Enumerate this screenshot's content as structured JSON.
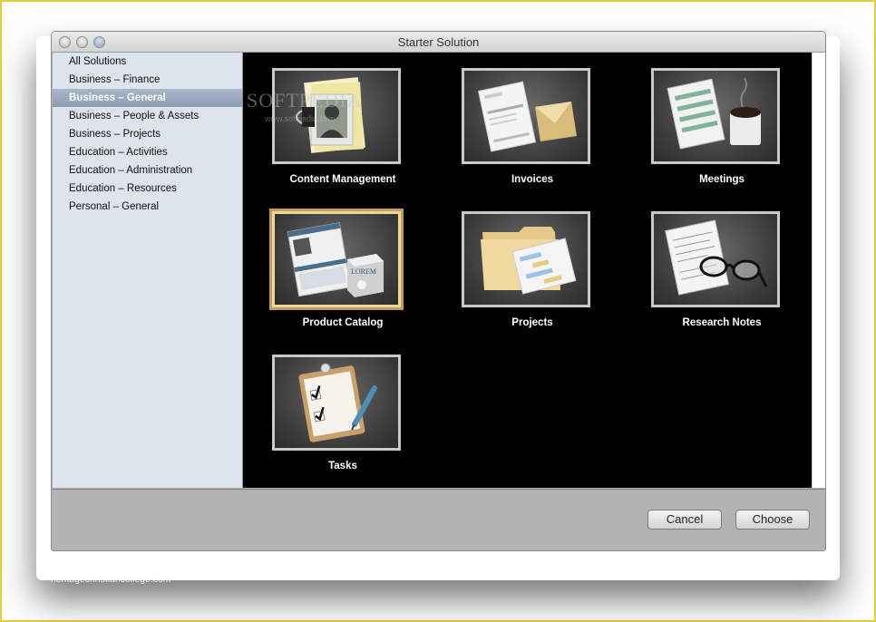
{
  "window": {
    "title": "Starter Solution"
  },
  "sidebar": {
    "items": [
      {
        "label": "All Solutions",
        "selected": false
      },
      {
        "label": "Business – Finance",
        "selected": false
      },
      {
        "label": "Business – General",
        "selected": true
      },
      {
        "label": "Business – People & Assets",
        "selected": false
      },
      {
        "label": "Business – Projects",
        "selected": false
      },
      {
        "label": "Education – Activities",
        "selected": false
      },
      {
        "label": "Education – Administration",
        "selected": false
      },
      {
        "label": "Education – Resources",
        "selected": false
      },
      {
        "label": "Personal – General",
        "selected": false
      }
    ]
  },
  "solutions": [
    {
      "label": "Content Management",
      "icon": "photo-notepad-icon",
      "selected": false
    },
    {
      "label": "Invoices",
      "icon": "invoice-envelope-icon",
      "selected": false
    },
    {
      "label": "Meetings",
      "icon": "agenda-coffee-icon",
      "selected": false
    },
    {
      "label": "Product Catalog",
      "icon": "catalog-box-icon",
      "selected": true
    },
    {
      "label": "Projects",
      "icon": "folder-gantt-icon",
      "selected": false
    },
    {
      "label": "Research Notes",
      "icon": "notes-glasses-icon",
      "selected": false
    },
    {
      "label": "Tasks",
      "icon": "clipboard-pen-icon",
      "selected": false
    }
  ],
  "footer": {
    "cancel_label": "Cancel",
    "choose_label": "Choose"
  },
  "overlays": {
    "softpedia": "SOFTPEDIA",
    "softpedia_url": "www.softpedia.com",
    "watermark": "heritagechristiancollege.com"
  },
  "colors": {
    "selection_border": "#c69c56",
    "sidebar_bg": "#dde4ed",
    "sidebar_selected": "#96a6bb",
    "frame": "#e6cd3c"
  }
}
